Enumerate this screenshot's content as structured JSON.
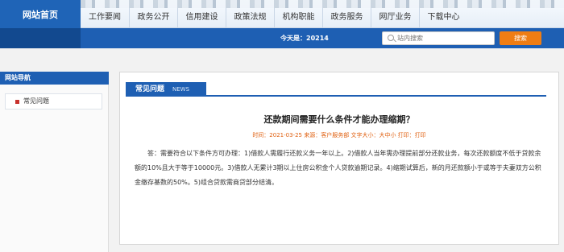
{
  "header": {
    "home_label": "网站首页",
    "nav": [
      "工作要闻",
      "政务公开",
      "信用建设",
      "政策法规",
      "机构职能",
      "政务服务",
      "网厅业务",
      "下载中心"
    ],
    "today_label": "今天是：20214",
    "search_placeholder": "站内搜索",
    "search_button": "搜索"
  },
  "sidebar": {
    "title": "网站导航",
    "items": [
      {
        "label": "常见问题"
      }
    ]
  },
  "main": {
    "section_title": "常见问题",
    "section_en": "NEWS",
    "article": {
      "title": "还款期间需要什么条件才能办理缩期？",
      "meta": "时间：2021-03-25 来源：客户服务部 文字大小：大中小 打印：打印",
      "body": "答：需要符合以下条件方可办理：1)借款人需履行还款义务一年以上。2)借款人当年需办理提前部分还款业务，每次还款额度不低于贷款余额的10%且大于等于10000元。3)借款人无累计3期以上住房公积金个人贷款逾期记录。4)缩期试算后，新的月还款额小于或等于夫妻双方公积金缴存基数的50%。5)组合贷款需商贷部分结清。"
    }
  },
  "colors": {
    "primary_blue": "#1e5fb3",
    "accent_orange": "#ef7d14",
    "meta_orange": "#e06010"
  }
}
